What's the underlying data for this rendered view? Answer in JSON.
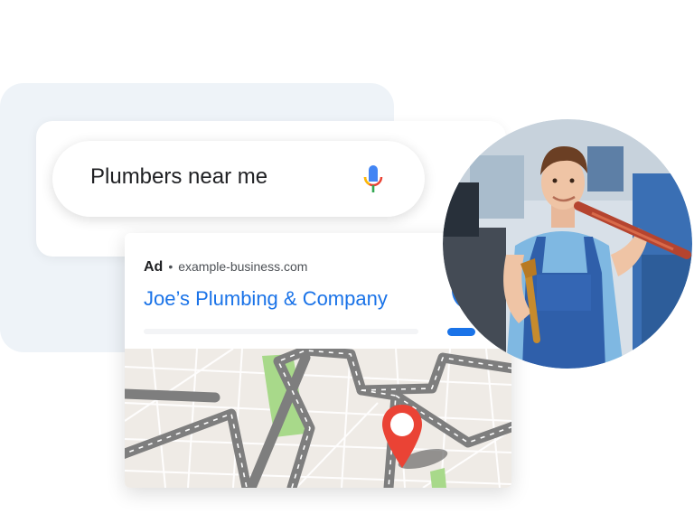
{
  "search": {
    "query": "Plumbers near me",
    "mic_icon": "microphone-icon"
  },
  "ad": {
    "label": "Ad",
    "separator": "•",
    "domain": "example-business.com",
    "title": "Joe’s Plumbing & Company",
    "call_icon": "phone-icon",
    "map_pin_icon": "map-pin-icon"
  },
  "photo": {
    "subject": "plumber-photo"
  },
  "colors": {
    "link_blue": "#1a73e8",
    "pin_red": "#ea4335",
    "park_green": "#a8d98a",
    "panel_bg": "#eef3f8"
  }
}
